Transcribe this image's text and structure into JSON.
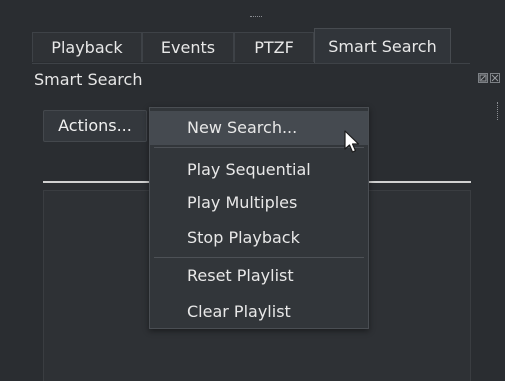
{
  "tabs": [
    {
      "label": "Playback",
      "active": false
    },
    {
      "label": "Events",
      "active": false
    },
    {
      "label": "PTZF",
      "active": false
    },
    {
      "label": "Smart Search",
      "active": true
    }
  ],
  "panel": {
    "title": "Smart Search",
    "float_icon": "float-icon",
    "close_icon": "close-icon"
  },
  "actions_button": {
    "label": "Actions..."
  },
  "menu": {
    "items": [
      {
        "label": "New Search...",
        "hover": true
      },
      {
        "label": "Play Sequential"
      },
      {
        "label": "Play Multiples"
      },
      {
        "label": "Stop Playback"
      },
      {
        "label": "Reset Playlist"
      },
      {
        "label": "Clear Playlist"
      }
    ]
  },
  "colors": {
    "background": "#2a2d31",
    "menu_background": "#32363a",
    "menu_hover": "#454a50",
    "text": "#e8e8e8"
  }
}
